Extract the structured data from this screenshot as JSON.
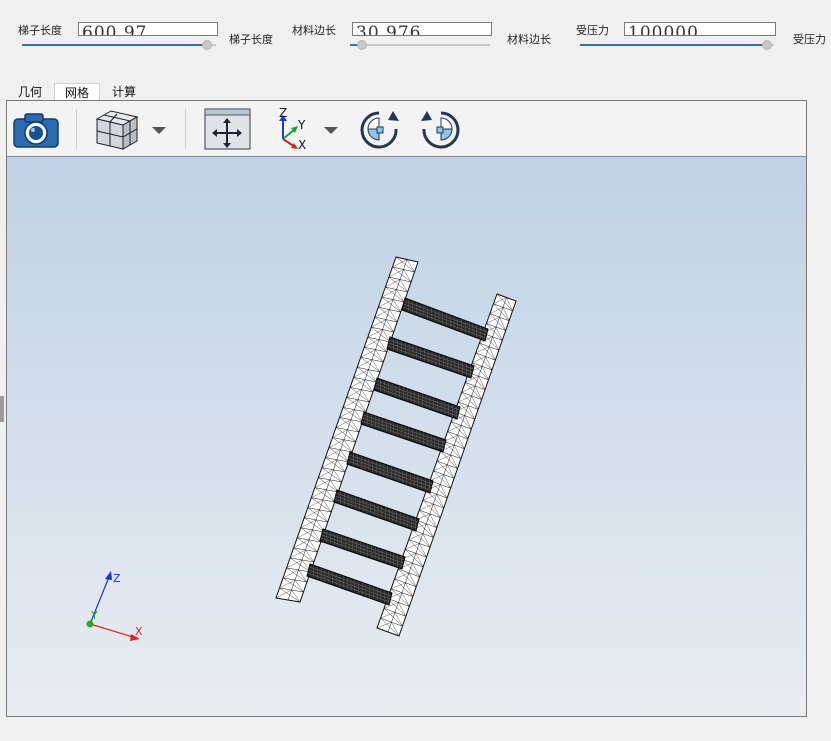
{
  "params": [
    {
      "label": "梯子长度",
      "value": "600.97",
      "unit_label": "梯子长度",
      "level": 0.98
    },
    {
      "label": "材料边长",
      "value": "30.976",
      "unit_label": "材料边长",
      "level": 0.05
    },
    {
      "label": "受压力",
      "value": "100000",
      "unit_label": "受压力",
      "level": 0.99
    }
  ],
  "tabs": [
    "几何",
    "网格",
    "计算"
  ],
  "active_tab": "网格",
  "toolbar": {
    "items": [
      "camera-icon",
      "cube-view-icon",
      "dropdown-arrow-icon",
      "fit-view-icon",
      "axis-orientation-icon",
      "dropdown-arrow-icon",
      "rotate-clockwise-icon",
      "rotate-counterclockwise-icon"
    ],
    "axis_labels": {
      "z": "Z",
      "y": "Y",
      "x": "X"
    }
  },
  "triad": {
    "z": "Z",
    "y": "Y",
    "x": "X"
  },
  "colors": {
    "accent": "#2f6fc0",
    "viewport_top": "#bed1e6",
    "viewport_bottom": "#e9ecef",
    "axis_x": "#e02020",
    "axis_y": "#20b020",
    "axis_z": "#2030d0"
  }
}
